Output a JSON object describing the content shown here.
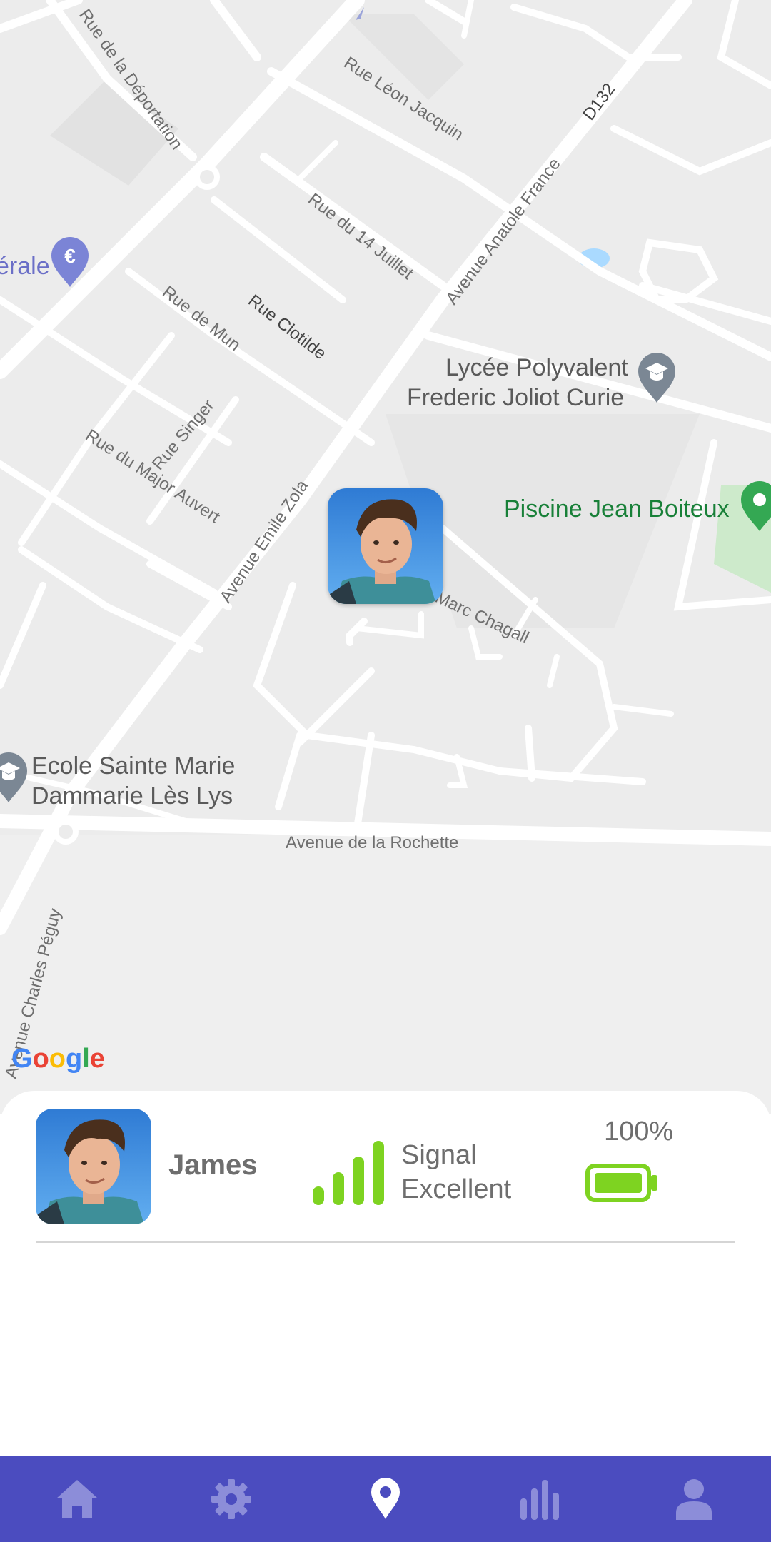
{
  "map": {
    "streets": [
      "Rue de la Déportation",
      "Rue Léon Jacquin",
      "D132",
      "Avenue Anatole France",
      "Rue du 14 Juillet",
      "Rue Clotilde",
      "Rue de Mun",
      "Rue Singer",
      "Rue du Major Auvert",
      "Avenue Emile Zola",
      "Marc Chagall",
      "Avenue de la Rochette",
      "Avenue Charles Péguy"
    ],
    "pois": {
      "bank": "érale",
      "lycee_line1": "Lycée Polyvalent",
      "lycee_line2": "Frederic Joliot Curie",
      "piscine": "Piscine Jean Boiteux",
      "ecole_line1": "Ecole Sainte Marie",
      "ecole_line2": "Dammarie Lès Lys"
    },
    "google": [
      "G",
      "o",
      "o",
      "g",
      "l",
      "e"
    ],
    "marker_icon": "child-avatar"
  },
  "device": {
    "name": "James",
    "signal_label": "Signal",
    "signal_value": "Excellent",
    "signal_bars": 4,
    "battery_percent_text": "100%",
    "battery_level": 1.0
  },
  "nav": {
    "items": [
      "home-icon",
      "settings-gear-icon",
      "location-pin-icon",
      "stats-bars-icon",
      "profile-person-icon"
    ],
    "active": "location-pin-icon"
  },
  "colors": {
    "nav_bg": "#4b4cbf",
    "signal_green": "#7ed321",
    "poi_green": "#188038",
    "poi_gray": "#7b8794",
    "bank_pin": "#7b84d6"
  }
}
